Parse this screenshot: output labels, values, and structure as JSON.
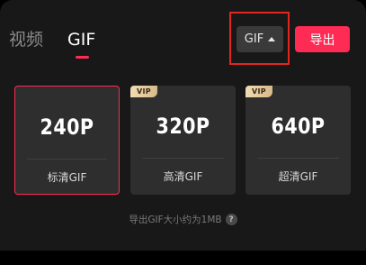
{
  "tabs": [
    {
      "label": "视频",
      "active": false
    },
    {
      "label": "GIF",
      "active": true
    }
  ],
  "format_select": {
    "value": "GIF"
  },
  "export_button": {
    "label": "导出"
  },
  "options": [
    {
      "resolution": "240P",
      "label": "标清GIF",
      "vip": false,
      "selected": true
    },
    {
      "resolution": "320P",
      "label": "高清GIF",
      "vip": true,
      "vip_text": "VIP",
      "selected": false
    },
    {
      "resolution": "640P",
      "label": "超清GIF",
      "vip": true,
      "vip_text": "VIP",
      "selected": false
    }
  ],
  "hint": {
    "text": "导出GIF大小约为1MB",
    "icon": "question-icon",
    "icon_glyph": "?"
  },
  "colors": {
    "accent": "#fe2c55",
    "background": "#181818",
    "card": "#2e2e2e",
    "highlight_box": "#e0261f"
  }
}
